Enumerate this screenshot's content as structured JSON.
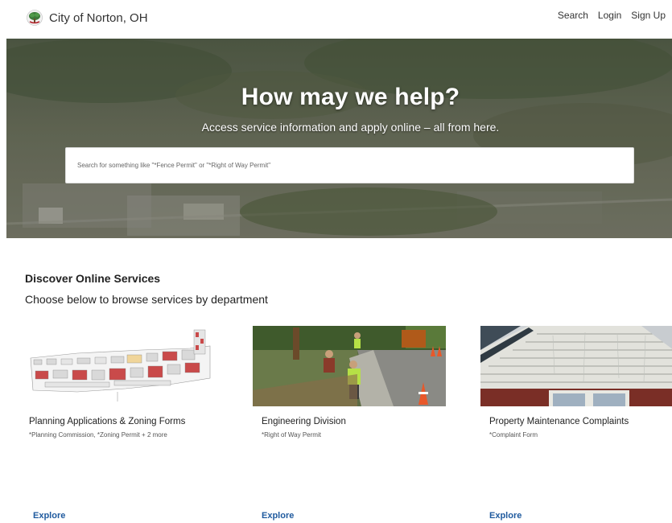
{
  "header": {
    "site_name": "City of Norton, OH",
    "logo_icon": "city-seal-tree-icon",
    "nav": [
      "Search",
      "Login",
      "Sign Up"
    ]
  },
  "hero": {
    "title": "How may we help?",
    "subtitle": "Access service information and apply online – all from here.",
    "search_placeholder": "Search for something like \"*Fence Permit\" or \"*Right of Way Permit\""
  },
  "services": {
    "title": "Discover Online Services",
    "subtitle": "Choose below to browse services by department",
    "cards": [
      {
        "title": "Planning Applications & Zoning Forms",
        "tags": "*Planning Commission, *Zoning Permit + 2 more",
        "link": "Explore"
      },
      {
        "title": "Engineering Division",
        "tags": "*Right of Way Permit",
        "link": "Explore"
      },
      {
        "title": "Property Maintenance Complaints",
        "tags": "*Complaint Form",
        "link": "Explore"
      }
    ]
  },
  "colors": {
    "link": "#1f5a9e",
    "hero_overlay": "#6b6f5c"
  }
}
